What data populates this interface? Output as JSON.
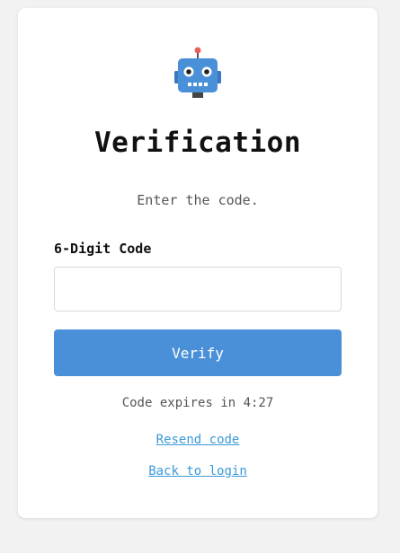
{
  "colors": {
    "background": "#f2f2f2",
    "card": "#ffffff",
    "accent": "#4a90d9",
    "link": "#3a9ad9",
    "robot_body": "#4a90d9",
    "robot_antenna_tip": "#e8605a"
  },
  "logo": {
    "icon": "robot-icon"
  },
  "page": {
    "title": "Verification",
    "subtitle": "Enter the code."
  },
  "form": {
    "code_label": "6-Digit Code",
    "code_value": "",
    "code_placeholder": "",
    "verify_label": "Verify"
  },
  "status": {
    "expires_text": "Code expires in 4:27"
  },
  "links": {
    "resend": "Resend code",
    "back": "Back to login"
  }
}
